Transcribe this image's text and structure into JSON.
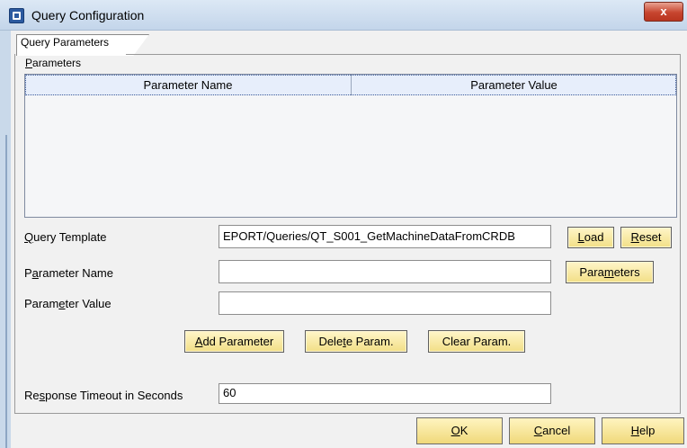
{
  "window": {
    "title": "Query Configuration",
    "close_glyph": "x",
    "icon": "app-icon"
  },
  "tab": {
    "label": "Query Parameters"
  },
  "parameters_section": {
    "label": "Parameters"
  },
  "table": {
    "columns": [
      "Parameter Name",
      "Parameter Value"
    ],
    "rows": []
  },
  "form": {
    "query_template": {
      "label": "Query Template",
      "value": "EPORT/Queries/QT_S001_GetMachineDataFromCRDB"
    },
    "parameter_name": {
      "label": "Parameter Name",
      "value": ""
    },
    "parameter_value": {
      "label": "Parameter Value",
      "value": ""
    },
    "response_timeout": {
      "label": "Response Timeout in Seconds",
      "value": "60"
    }
  },
  "buttons": {
    "load": "Load",
    "reset": "Reset",
    "parameters": "Parameters",
    "add_parameter": "Add Parameter",
    "delete_param": "Delete Param.",
    "clear_param": "Clear Param.",
    "ok": "OK",
    "cancel": "Cancel",
    "help": "Help"
  }
}
